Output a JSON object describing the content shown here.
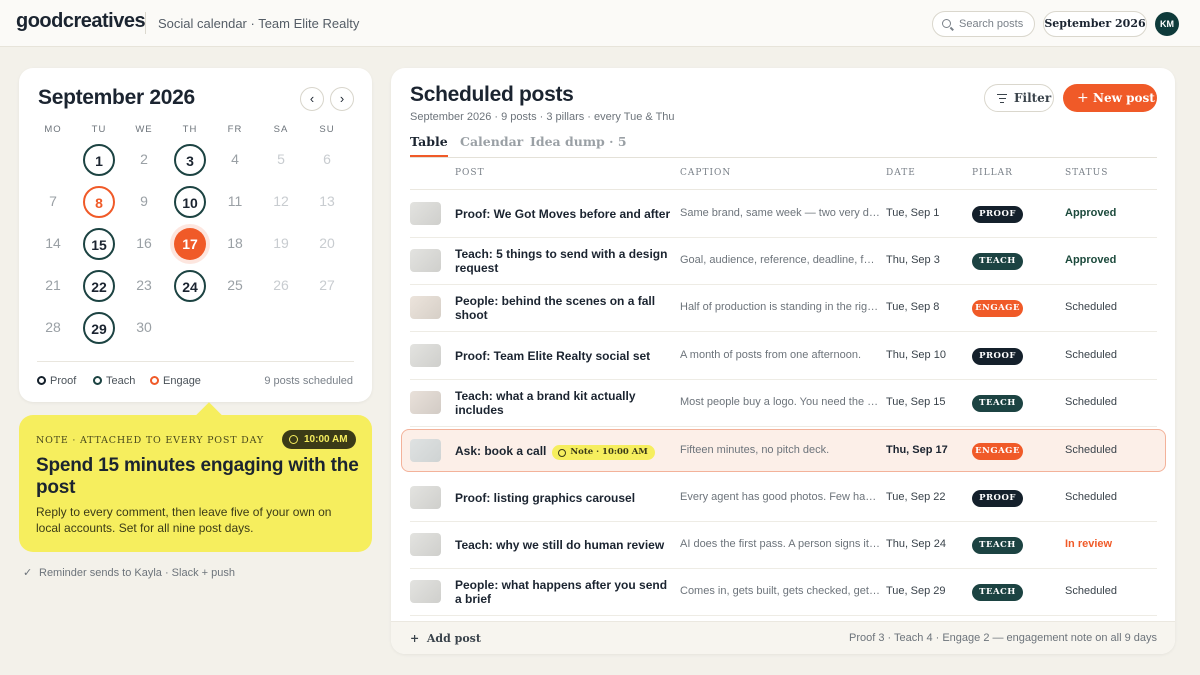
{
  "topbar": {
    "logo": "goodcreatives",
    "crumb": "Social calendar · Team Elite Realty",
    "search_placeholder": "Search posts",
    "month": "September 2026",
    "avatar": "KM"
  },
  "calendar": {
    "title": "September 2026",
    "prev": "‹",
    "next": "›",
    "weekdays": [
      "MO",
      "TU",
      "WE",
      "TH",
      "FR",
      "SA",
      "SU"
    ],
    "legend": {
      "proof": "Proof",
      "teach": "Teach",
      "engage": "Engage"
    },
    "count": "9 posts scheduled"
  },
  "note": {
    "label": "NOTE · ATTACHED TO EVERY POST DAY",
    "time": "10:00 AM",
    "title": "Spend 15 minutes engaging with the post",
    "body": "Reply to every comment, then leave five of your own on local accounts. Set for all nine post days.",
    "reminder": "Reminder sends to Kayla · Slack + push"
  },
  "main": {
    "title": "Scheduled posts",
    "subtitle": "September 2026 · 9 posts · 3 pillars · every Tue & Thu",
    "filter": "Filter",
    "new_post": "New post",
    "tabs": [
      "Table",
      "Calendar",
      "Idea dump · 5"
    ],
    "columns": [
      "POST",
      "CAPTION",
      "DATE",
      "PILLAR",
      "STATUS"
    ],
    "rows": [
      {
        "post": "Proof: We Got Moves before and after",
        "caption": "Same brand, same week — two very different …",
        "date": "Tue, Sep 1",
        "pillar": "PROOF",
        "status": "Approved"
      },
      {
        "post": "Teach: 5 things to send with a design request",
        "caption": "Goal, audience, reference, deadline, format.",
        "date": "Thu, Sep 3",
        "pillar": "TEACH",
        "status": "Approved"
      },
      {
        "post": "People: behind the scenes on a fall shoot",
        "caption": "Half of production is standing in the right place.",
        "date": "Tue, Sep 8",
        "pillar": "ENGAGE",
        "status": "Scheduled"
      },
      {
        "post": "Proof: Team Elite Realty social set",
        "caption": "A month of posts from one afternoon.",
        "date": "Thu, Sep 10",
        "pillar": "PROOF",
        "status": "Scheduled"
      },
      {
        "post": "Teach: what a brand kit actually includes",
        "caption": "Most people buy a logo. You need the rest.",
        "date": "Tue, Sep 15",
        "pillar": "TEACH",
        "status": "Scheduled"
      },
      {
        "post": "Ask: book a call",
        "note": "Note · 10:00 AM",
        "caption": "Fifteen minutes, no pitch deck.",
        "date": "Thu, Sep 17",
        "pillar": "ENGAGE",
        "status": "Scheduled"
      },
      {
        "post": "Proof: listing graphics carousel",
        "caption": "Every agent has good photos. Few have a system.",
        "date": "Tue, Sep 22",
        "pillar": "PROOF",
        "status": "Scheduled"
      },
      {
        "post": "Teach: why we still do human review",
        "caption": "AI does the first pass. A person signs it off.",
        "date": "Thu, Sep 24",
        "pillar": "TEACH",
        "status": "In review"
      },
      {
        "post": "People: what happens after you send a brief",
        "caption": "Comes in, gets built, gets checked, gets sent.",
        "date": "Tue, Sep 29",
        "pillar": "TEACH",
        "status": "Scheduled"
      }
    ],
    "add_post": "Add post",
    "summary": "Proof 3 · Teach 4 · Engage 2 — engagement note on all 9 days"
  },
  "colors": {
    "accent": "#f05a28",
    "teal": "#1c4342",
    "navy": "#14202b",
    "note_yellow": "#f6ee5e"
  },
  "icons": [
    "search-icon",
    "chevron-left-icon",
    "chevron-right-icon",
    "filter-icon",
    "plus-icon",
    "clock-icon",
    "check-icon"
  ]
}
